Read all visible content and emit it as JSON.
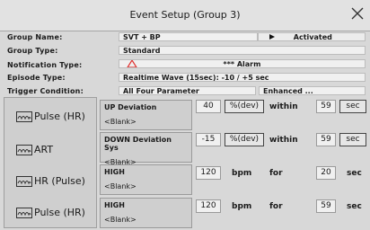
{
  "window": {
    "title": "Event Setup (Group 3)"
  },
  "fields": {
    "group_name": {
      "label": "Group Name:",
      "value": "SVT + BP"
    },
    "group_type": {
      "label": "Group Type:",
      "value": "Standard"
    },
    "notification_type": {
      "label": "Notification Type:",
      "value": "*** Alarm"
    },
    "episode_type": {
      "label": "Episode Type:",
      "value": "Realtime Wave (15sec): -10 / +5 sec"
    },
    "trigger_condition": {
      "label": "Trigger Condition:",
      "value": "All Four Parameter",
      "mode": "Enhanced ..."
    },
    "status": {
      "value": "Activated"
    }
  },
  "params": [
    {
      "name": "Pulse (HR)",
      "icon": "waveform-icon"
    },
    {
      "name": "ART",
      "icon": "waveform-icon"
    },
    {
      "name": "HR (Pulse)",
      "icon": "waveform-icon"
    },
    {
      "name": "Pulse (HR)",
      "icon": "waveform-icon"
    }
  ],
  "conditions": [
    {
      "title": "UP Deviation",
      "sub": "<Blank>",
      "value": "40",
      "unit": "%(dev)",
      "op": "within",
      "time": "59",
      "time_unit": "sec"
    },
    {
      "title": "DOWN Deviation Sys",
      "sub": "<Blank>",
      "value": "-15",
      "unit": "%(dev)",
      "op": "within",
      "time": "59",
      "time_unit": "sec"
    },
    {
      "title": "HIGH",
      "sub": "<Blank>",
      "value": "120",
      "unit": "bpm",
      "op": "for",
      "time": "20",
      "time_unit": "sec"
    },
    {
      "title": "HIGH",
      "sub": "<Blank>",
      "value": "120",
      "unit": "bpm",
      "op": "for",
      "time": "59",
      "time_unit": "sec"
    }
  ],
  "colors": {
    "alarm_icon": "#e0302e",
    "background": "#d8d8d8"
  }
}
